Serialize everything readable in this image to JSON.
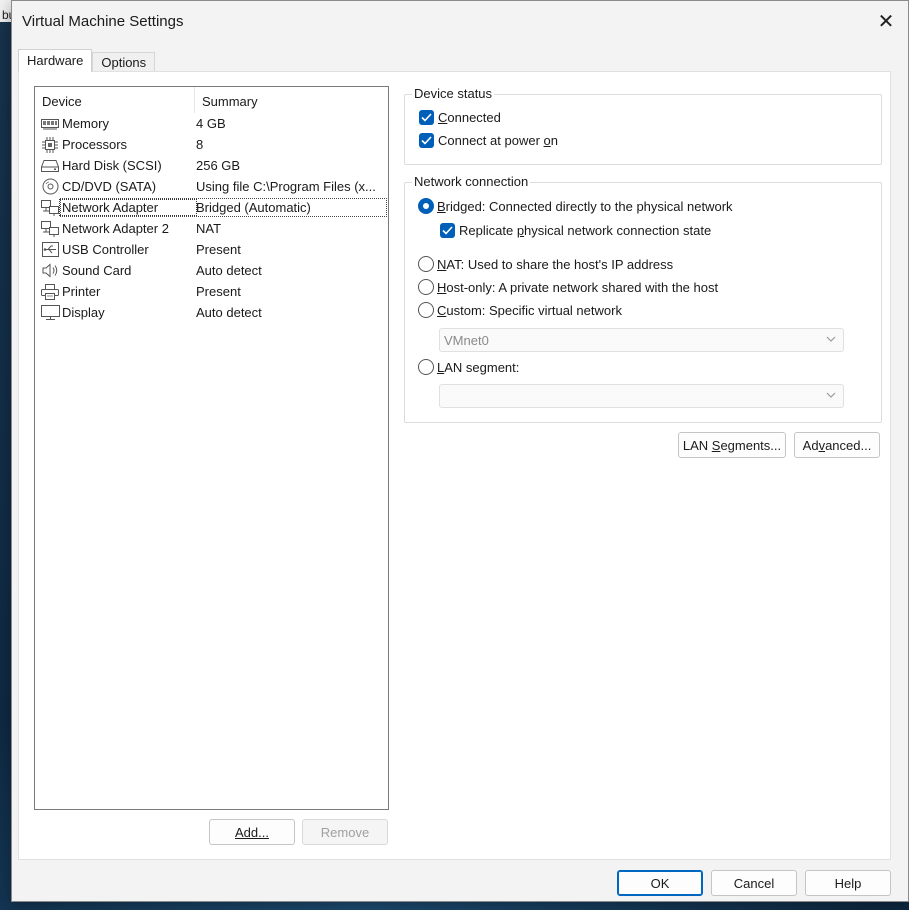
{
  "window": {
    "title": "Virtual Machine Settings",
    "close_glyph": "✕",
    "behind_text": "bu"
  },
  "tabs": [
    {
      "label": "Hardware",
      "active": true
    },
    {
      "label": "Options",
      "active": false
    }
  ],
  "device_list": {
    "columns": {
      "device": "Device",
      "summary": "Summary"
    },
    "rows": [
      {
        "device": "Memory",
        "summary": "4 GB",
        "icon": "memory-icon"
      },
      {
        "device": "Processors",
        "summary": "8",
        "icon": "processor-icon"
      },
      {
        "device": "Hard Disk (SCSI)",
        "summary": "256 GB",
        "icon": "hard-disk-icon"
      },
      {
        "device": "CD/DVD (SATA)",
        "summary": "Using file C:\\Program Files (x...",
        "icon": "cd-dvd-icon"
      },
      {
        "device": "Network Adapter",
        "summary": "Bridged (Automatic)",
        "icon": "network-adapter-icon",
        "selected": true
      },
      {
        "device": "Network Adapter 2",
        "summary": "NAT",
        "icon": "network-adapter-icon"
      },
      {
        "device": "USB Controller",
        "summary": "Present",
        "icon": "usb-icon"
      },
      {
        "device": "Sound Card",
        "summary": "Auto detect",
        "icon": "speaker-icon"
      },
      {
        "device": "Printer",
        "summary": "Present",
        "icon": "printer-icon"
      },
      {
        "device": "Display",
        "summary": "Auto detect",
        "icon": "display-icon"
      }
    ],
    "add_label": "Add...",
    "remove_label": "Remove"
  },
  "device_status": {
    "legend": "Device status",
    "connected": {
      "prefix": "C",
      "rest": "onnected",
      "checked": true
    },
    "connect_power": {
      "prefix": "Connect at power ",
      "u": "o",
      "rest": "n",
      "checked": true
    }
  },
  "network_connection": {
    "legend": "Network connection",
    "bridged": {
      "u": "B",
      "rest": "ridged: Connected directly to the physical network",
      "selected": true
    },
    "replicate": {
      "prefix": "Replicate ",
      "u": "p",
      "rest": "hysical network connection state",
      "checked": true
    },
    "nat": {
      "u": "N",
      "rest": "AT: Used to share the host's IP address",
      "selected": false
    },
    "host_only": {
      "u": "H",
      "rest": "ost-only: A private network shared with the host",
      "selected": false
    },
    "custom": {
      "u": "C",
      "rest": "ustom: Specific virtual network",
      "selected": false
    },
    "custom_select_value": "VMnet0",
    "lan_segment": {
      "u": "L",
      "rest": "AN segment:",
      "selected": false
    },
    "lan_select_value": ""
  },
  "buttons": {
    "lan_segments": {
      "prefix": "LAN ",
      "u": "S",
      "rest": "egments..."
    },
    "advanced": {
      "prefix": "Ad",
      "u": "v",
      "rest": "anced..."
    },
    "ok": "OK",
    "cancel": "Cancel",
    "help": "Help"
  },
  "colors": {
    "accent": "#005fb8",
    "dialog_bg": "#f3f3f3",
    "panel_bg": "#ffffff"
  }
}
